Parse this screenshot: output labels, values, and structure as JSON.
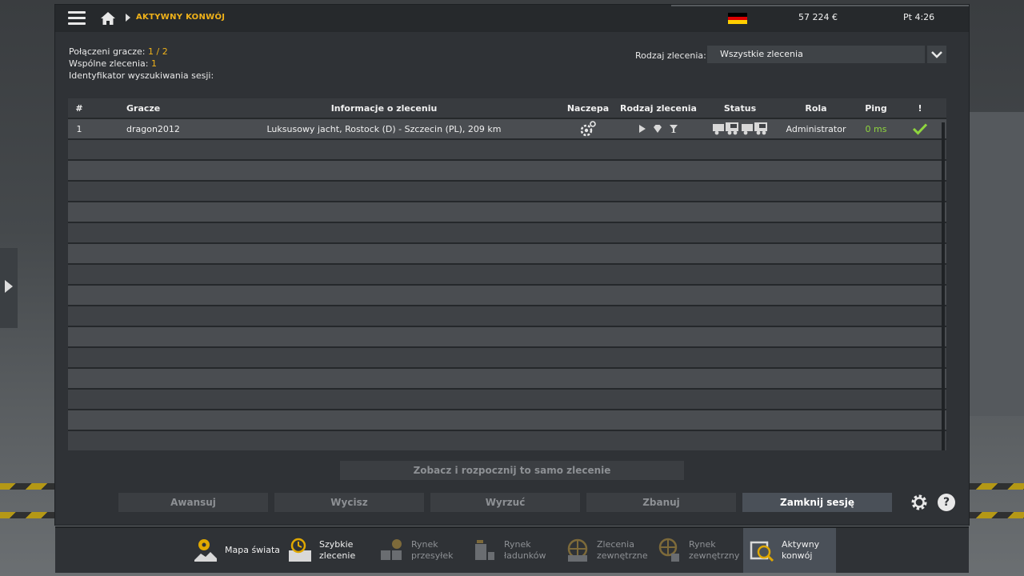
{
  "topbar": {
    "breadcrumb": "AKTYWNY KONWÓJ",
    "money": "57 224 €",
    "clock": "Pt 4:26",
    "flag_colors": [
      "#000000",
      "#dd0000",
      "#ffce00"
    ]
  },
  "info": {
    "players_label": "Połączeni gracze:",
    "players_value": "1 / 2",
    "shared_label": "Wspólne zlecenia:",
    "shared_value": "1",
    "session_label": "Identyfikator wyszukiwania sesji:"
  },
  "filter": {
    "label": "Rodzaj zlecenia:",
    "selected": "Wszystkie zlecenia"
  },
  "table": {
    "headers": {
      "num": "#",
      "player": "Gracze",
      "info": "Informacje o zleceniu",
      "trailer": "Naczepa",
      "type": "Rodzaj zlecenia",
      "status": "Status",
      "role": "Rola",
      "ping": "Ping",
      "flag": "!"
    },
    "rows": [
      {
        "num": "1",
        "player": "dragon2012",
        "info": "Luksusowy jacht, Rostock (D) - Szczecin (PL), 209 km",
        "role": "Administrator",
        "ping": "0 ms"
      }
    ]
  },
  "buttons": {
    "view_start": "Zobacz i rozpocznij to samo zlecenie",
    "promote": "Awansuj",
    "mute": "Wycisz",
    "kick": "Wyrzuć",
    "ban": "Zbanuj",
    "close_session": "Zamknij sesję",
    "help": "?"
  },
  "nav": {
    "world_map": "Mapa świata",
    "quick_job_1": "Szybkie",
    "quick_job_2": "zlecenie",
    "freight_1": "Rynek",
    "freight_2": "przesyłek",
    "cargo_1": "Rynek",
    "cargo_2": "ładunków",
    "external_jobs_1": "Zlecenia",
    "external_jobs_2": "zewnętrzne",
    "external_market_1": "Rynek",
    "external_market_2": "zewnętrzny",
    "convoy_1": "Aktywny",
    "convoy_2": "konwój"
  },
  "colors": {
    "accent": "#f0b21a",
    "ping_good": "#8fd63e",
    "check": "#8fd63e"
  }
}
